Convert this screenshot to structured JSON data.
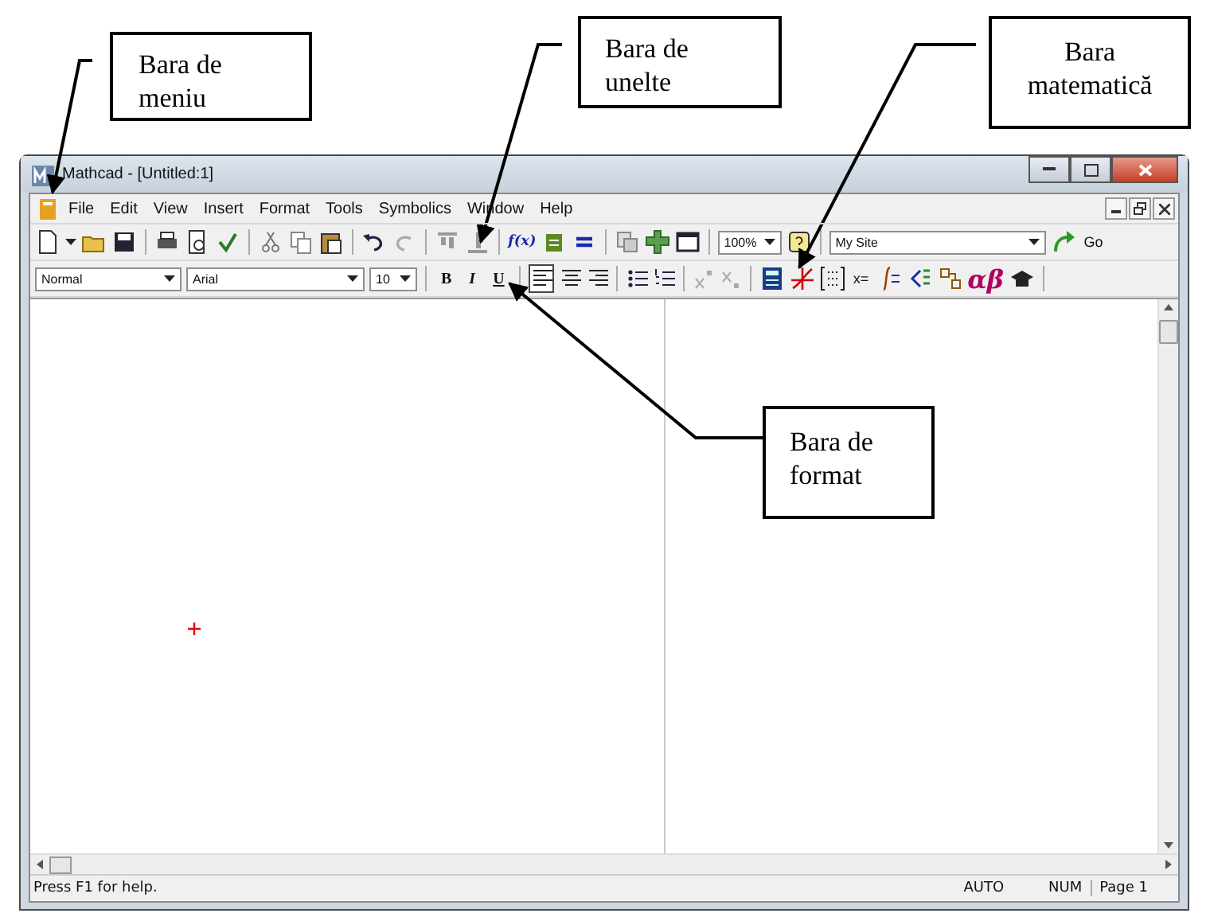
{
  "callouts": [
    {
      "text": "Bara de meniu"
    },
    {
      "text": "Bara de unelte"
    },
    {
      "text": "Bara matematică"
    },
    {
      "text": "Bara de format"
    }
  ],
  "window": {
    "title": "Mathcad - [Untitled:1]"
  },
  "menu": [
    "File",
    "Edit",
    "View",
    "Insert",
    "Format",
    "Tools",
    "Symbolics",
    "Window",
    "Help"
  ],
  "standard_toolbar": {
    "function_label": "f(x)",
    "zoom": "100%",
    "site": "My Site",
    "go": "Go"
  },
  "format_toolbar": {
    "style": "Normal",
    "font": "Arial",
    "size": "10",
    "bold": "B",
    "italic": "I",
    "underline": "U"
  },
  "math_toolbar": {
    "evaluate_label": "x=",
    "greek_label": "αβ"
  },
  "status_bar": {
    "help": "Press F1 for help.",
    "mode": "AUTO",
    "num": "NUM",
    "page": "Page 1"
  }
}
